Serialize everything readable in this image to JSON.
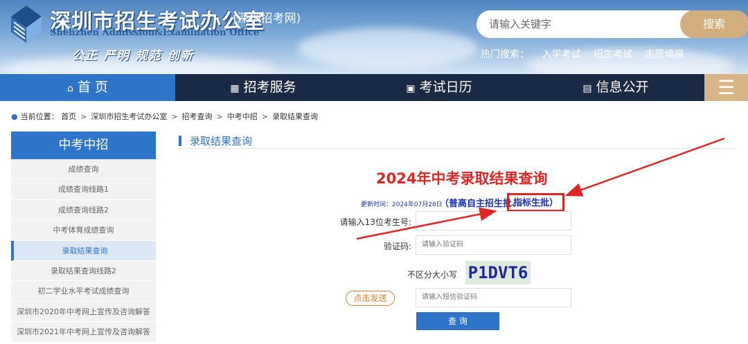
{
  "header": {
    "title": "深圳市招生考试办公室",
    "subtitle": "(深圳招考网)",
    "title_en": "Shenzhen Admission&Examination Office",
    "slogan": "公正 严明 规范 创新",
    "search_placeholder": "请输入关键字",
    "search_button": "搜索",
    "hot_label": "热门搜索：",
    "hot_items": [
      "入学考试",
      "招生考试",
      "志愿填报"
    ]
  },
  "nav": {
    "home": "首 页",
    "services": "招考服务",
    "calendar": "考试日历",
    "info": "信息公开",
    "menu_icon": "☰"
  },
  "breadcrumb": {
    "label": "当前位置：",
    "items": [
      "首页",
      "深圳市招生考试办公室",
      "招考查询",
      "中考中招",
      "录取结果查询"
    ]
  },
  "sidebar": {
    "header": "中考中招",
    "items": [
      {
        "label": "成绩查询"
      },
      {
        "label": "成绩查询线路1"
      },
      {
        "label": "成绩查询线路2"
      },
      {
        "label": "中考体育成绩查询"
      },
      {
        "label": "录取结果查询"
      },
      {
        "label": "录取结果查询线路2"
      },
      {
        "label": "初二学业水平考试成绩查询"
      },
      {
        "label": "深圳市2020年中考网上宣传及咨询解答"
      },
      {
        "label": "深圳市2021年中考网上宣传及咨询解答"
      }
    ]
  },
  "main": {
    "section_title": "录取结果查询",
    "query_title": "2024年中考录取结果查询",
    "update_time": "更新时间：2024年07月26日",
    "batch_text": "（普高自主招生批、",
    "batch_highlight": "指标生批）",
    "exam_no_label": "请输入13位考生号:",
    "captcha_label": "验证码:",
    "captcha_placeholder": "请输入验证码",
    "case_note": "不区分大小写",
    "captcha_text": "P1DVT6",
    "send_button": "点击发送",
    "sms_placeholder": "请输入短信验证码",
    "query_button": "查 询"
  },
  "colors": {
    "primary": "#2e74c8",
    "nav_dark": "#1b2a44",
    "accent_gold": "#d2ae7e",
    "highlight_red": "#e02525",
    "link_blue": "#1a2fb5"
  }
}
